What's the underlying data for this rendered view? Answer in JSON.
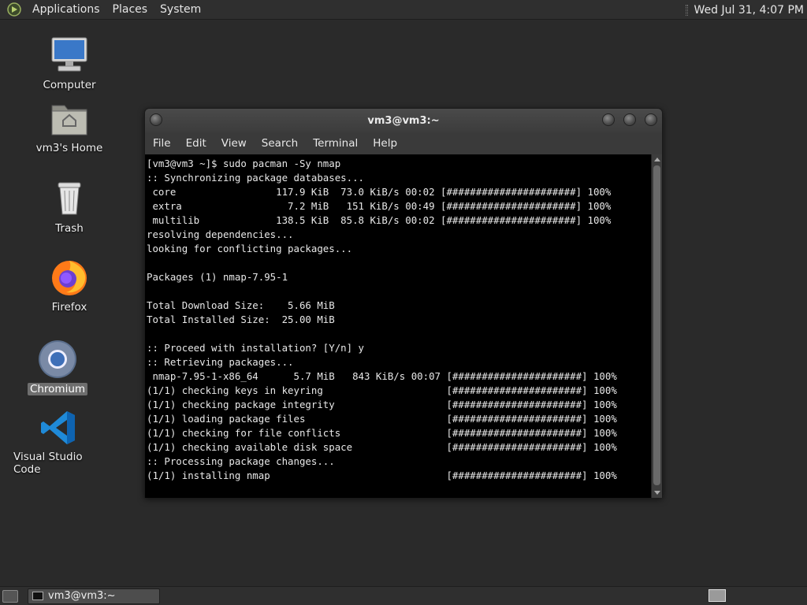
{
  "top_panel": {
    "menus": [
      "Applications",
      "Places",
      "System"
    ],
    "clock": "Wed Jul 31,  4:07 PM"
  },
  "desktop_icons": [
    {
      "label": "Computer",
      "icon": "computer-icon"
    },
    {
      "label": "vm3's Home",
      "icon": "home-folder-icon"
    },
    {
      "label": "Trash",
      "icon": "trash-icon"
    },
    {
      "label": "Firefox",
      "icon": "firefox-icon"
    },
    {
      "label": "Chromium",
      "icon": "chromium-icon",
      "selected": true
    },
    {
      "label": "Visual Studio Code",
      "icon": "vscode-icon"
    }
  ],
  "window": {
    "title": "vm3@vm3:~",
    "menus": [
      "File",
      "Edit",
      "View",
      "Search",
      "Terminal",
      "Help"
    ],
    "terminal_lines": [
      "[vm3@vm3 ~]$ sudo pacman -Sy nmap",
      ":: Synchronizing package databases...",
      " core                 117.9 KiB  73.0 KiB/s 00:02 [######################] 100%",
      " extra                  7.2 MiB   151 KiB/s 00:49 [######################] 100%",
      " multilib             138.5 KiB  85.8 KiB/s 00:02 [######################] 100%",
      "resolving dependencies...",
      "looking for conflicting packages...",
      "",
      "Packages (1) nmap-7.95-1",
      "",
      "Total Download Size:    5.66 MiB",
      "Total Installed Size:  25.00 MiB",
      "",
      ":: Proceed with installation? [Y/n] y",
      ":: Retrieving packages...",
      " nmap-7.95-1-x86_64      5.7 MiB   843 KiB/s 00:07 [######################] 100%",
      "(1/1) checking keys in keyring                     [######################] 100%",
      "(1/1) checking package integrity                   [######################] 100%",
      "(1/1) loading package files                        [######################] 100%",
      "(1/1) checking for file conflicts                  [######################] 100%",
      "(1/1) checking available disk space                [######################] 100%",
      ":: Processing package changes...",
      "(1/1) installing nmap                              [######################] 100%"
    ]
  },
  "taskbar": {
    "task_label": "vm3@vm3:~"
  }
}
